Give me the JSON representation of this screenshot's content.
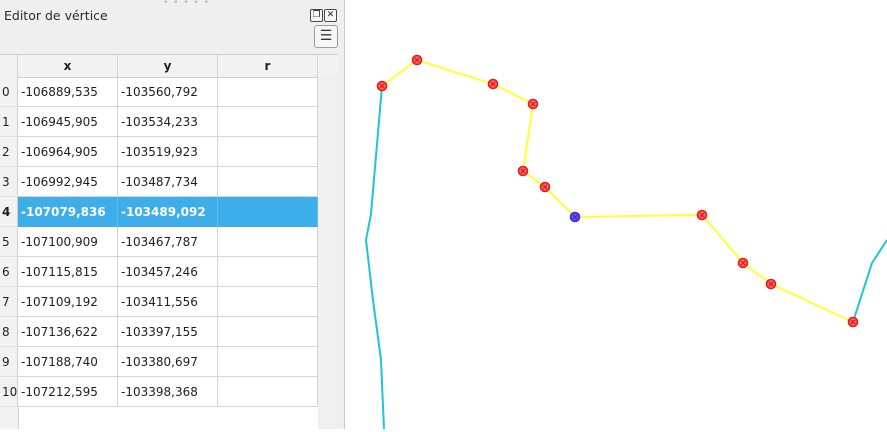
{
  "panel": {
    "title": "Editor de vértice",
    "float_icon": "float-icon",
    "close_icon": "close-icon",
    "menu_icon": "hamburger-menu-icon"
  },
  "table": {
    "columns": [
      "x",
      "y",
      "r"
    ],
    "selected_row": 4,
    "rows": [
      {
        "index": "0",
        "x": "-106889,535",
        "y": "-103560,792",
        "r": ""
      },
      {
        "index": "1",
        "x": "-106945,905",
        "y": "-103534,233",
        "r": ""
      },
      {
        "index": "2",
        "x": "-106964,905",
        "y": "-103519,923",
        "r": ""
      },
      {
        "index": "3",
        "x": "-106992,945",
        "y": "-103487,734",
        "r": ""
      },
      {
        "index": "4",
        "x": "-107079,836",
        "y": "-103489,092",
        "r": ""
      },
      {
        "index": "5",
        "x": "-107100,909",
        "y": "-103467,787",
        "r": ""
      },
      {
        "index": "6",
        "x": "-107115,815",
        "y": "-103457,246",
        "r": ""
      },
      {
        "index": "7",
        "x": "-107109,192",
        "y": "-103411,556",
        "r": ""
      },
      {
        "index": "8",
        "x": "-107136,622",
        "y": "-103397,155",
        "r": ""
      },
      {
        "index": "9",
        "x": "-107188,740",
        "y": "-103380,697",
        "r": ""
      },
      {
        "index": "10",
        "x": "-107212,595",
        "y": "-103398,368",
        "r": ""
      }
    ]
  },
  "map": {
    "edited_line_color": "#ffff33",
    "other_line_color": "#22c3d6",
    "vertex_color": "#e31a1c",
    "selected_vertex_color": "#3a2be0"
  }
}
